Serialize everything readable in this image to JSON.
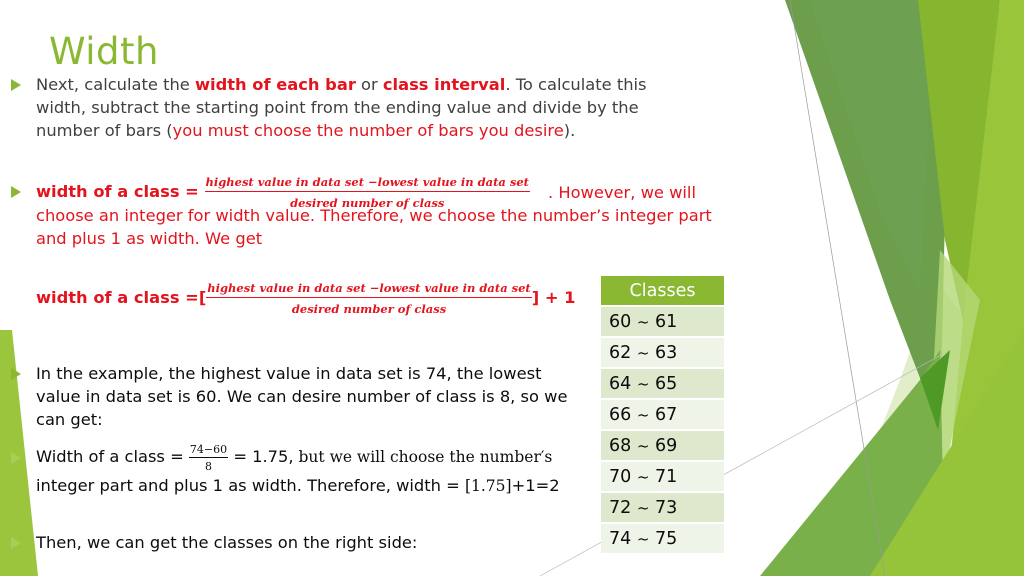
{
  "slide": {
    "title": "Width",
    "bullets": [
      {
        "parts": [
          {
            "text": "Next, calculate the ",
            "style": "normal"
          },
          {
            "text": "width of each bar",
            "style": "red-bold"
          },
          {
            "text": " or ",
            "style": "normal"
          },
          {
            "text": "class interval",
            "style": "red-bold"
          },
          {
            "text": ". To calculate this width, subtract the starting point from the ending value and divide by the number of bars (",
            "style": "normal"
          },
          {
            "text": "you must choose the number of bars you desire",
            "style": "red"
          },
          {
            "text": ").",
            "style": "normal"
          }
        ]
      },
      {
        "label": "width of a class = ",
        "fraction": {
          "numerator": "highest value in data set −lowest value in data set",
          "denominator": "desired number of class"
        },
        "after": ".  However, we will choose an integer for width value.   Therefore, we choose the number’s integer part and plus 1 as width.  We get"
      },
      {
        "label": "width of a class =[",
        "fraction": {
          "numerator": "highest value in data set −lowest value in data set",
          "denominator": "desired number of class"
        },
        "after": "] + 1"
      },
      {
        "text": "In the example, the highest value in data set is 74, the lowest value in data set is 60.  We can desire number of class is 8, so we can get:"
      },
      {
        "label": "Width of a class = ",
        "fraction": {
          "numerator": "74−60",
          "denominator": "8"
        },
        "result": "= 1.75,",
        "serif_text": " but we will choose the number′s",
        "line2": "integer part and plus 1 as width.  Therefore, width = ",
        "line2_serif": "[1.75]",
        "line2_end": "+1=2"
      },
      {
        "text": "Then, we can get the classes on the right side:"
      }
    ],
    "table": {
      "header": "Classes",
      "rows": [
        {
          "low": "60",
          "high": "61"
        },
        {
          "low": "62",
          "high": "63"
        },
        {
          "low": "64",
          "high": "65"
        },
        {
          "low": "66",
          "high": "67"
        },
        {
          "low": "68",
          "high": "69"
        },
        {
          "low": "70",
          "high": "71"
        },
        {
          "low": "72",
          "high": "73"
        },
        {
          "low": "74",
          "high": "75"
        }
      ],
      "separator": "~"
    }
  },
  "colors": {
    "accent_green": "#8ab833",
    "emphasis_red": "#e3141d",
    "body_text": "#404040"
  }
}
